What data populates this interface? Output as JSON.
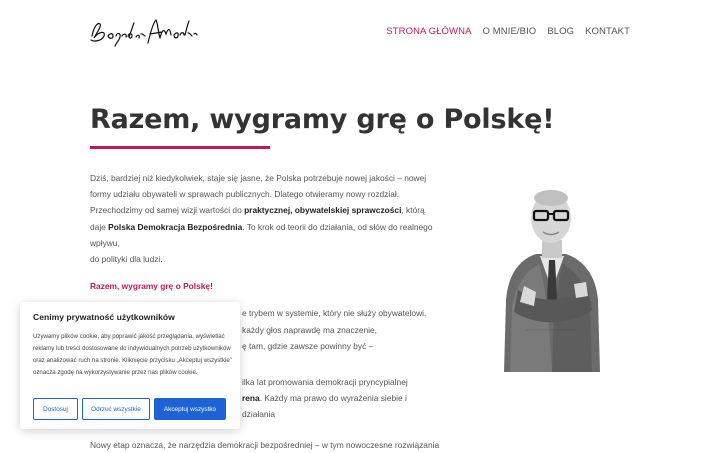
{
  "header": {
    "nav": [
      "STRONA GŁÓWNA",
      "O MNIE/BIO",
      "BLOG",
      "KONTAKT"
    ]
  },
  "hero": {
    "title": "Razem, wygramy grę o Polskę!"
  },
  "body": {
    "p1_a": "Dziś, bardziej niż kiedykolwiek, staje się jasne, że Polska potrzebuje nowej jakości – nowej",
    "p1_b": "formy udziału obywateli w sprawach publicznych. Dlatego otwieramy nowy rozdział.",
    "p1_c": "Przechodzimy od samej wizji wartości do",
    "p1_c_bold": "praktycznej, obywatelskiej sprawczości",
    "p1_c_end": ", którą",
    "p1_d": "daje",
    "p1_d_bold": "Polska Demokracja Bezpośrednia",
    "p1_d_end": ". To krok od teorii do działania, od słów do realnego",
    "p1_e": "wpływu,",
    "p1_f": "do polityki dla ludzi.",
    "subheading": "Razem, wygramy grę o Polskę!",
    "p2_a": "e trybem w systemie, który nie służy obywatelowi.",
    "p2_b": "każdy głos naprawdę ma znaczenie,",
    "p2_c": "ę tam, gdzie zawsze powinny być –",
    "p3_a": "ilka lat promowania demokracji pryncypialnej",
    "p3_b_bold": "rena",
    "p3_b_end": ". Każdy ma prawo do wyrażenia siebie i działania",
    "p4": "Nowy etap oznacza, że narzędzia demokracji bezpośredniej – w tym nowoczesne rozwiązania"
  },
  "cookie": {
    "title": "Cenimy prywatność użytkowników",
    "text": "Używamy plików cookie, aby poprawić jakość przeglądania, wyświetlać reklamy lub treści dostosowane do indywidualnych potrzeb użytkowników oraz analizować ruch na stronie. Kliknięcie przycisku „Akceptuj wszystkie” oznacza zgodę na wykorzystywanie przez nas plików cookie.",
    "btn_customize": "Dostosuj",
    "btn_reject": "Odrzuć wszystkie",
    "btn_accept": "Akceptuj wszystko"
  },
  "colors": {
    "accent": "#c2185b",
    "button_blue": "#1e63d6"
  }
}
